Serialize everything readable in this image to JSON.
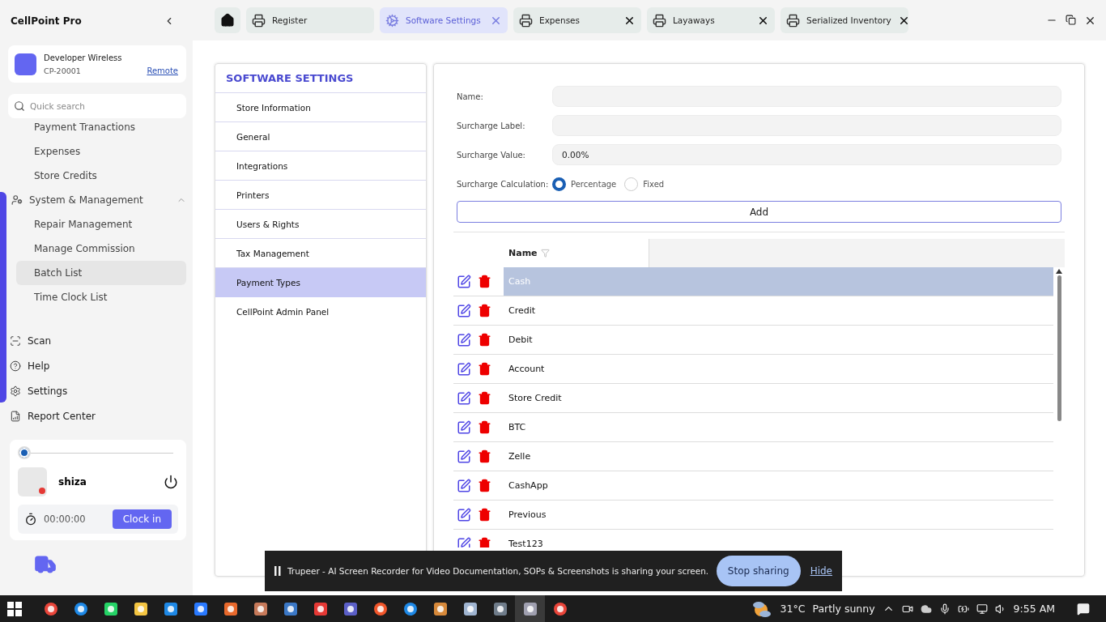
{
  "app": {
    "title": "CellPoint Pro"
  },
  "store": {
    "name": "Developer Wireless",
    "code": "CP-20001",
    "link": "Remote"
  },
  "search": {
    "placeholder": "Quick search"
  },
  "nav": {
    "items": [
      {
        "label": "Payment Tranactions",
        "selected": false
      },
      {
        "label": "Expenses",
        "selected": false
      },
      {
        "label": "Store Credits",
        "selected": false
      }
    ],
    "group": {
      "label": "System & Management",
      "expanded": true,
      "children": [
        {
          "label": "Repair Management",
          "selected": false
        },
        {
          "label": "Manage Commission",
          "selected": false
        },
        {
          "label": "Batch List",
          "selected": true
        },
        {
          "label": "Time Clock List",
          "selected": false
        }
      ]
    }
  },
  "shortcuts": [
    {
      "label": "Scan",
      "kind": "scan"
    },
    {
      "label": "Help",
      "kind": "help"
    },
    {
      "label": "Settings",
      "kind": "settings"
    },
    {
      "label": "Report Center",
      "kind": "report"
    }
  ],
  "user": {
    "name": "shiza",
    "slider": {
      "level": 0
    },
    "time": "00:00:00",
    "clock_button": "Clock in"
  },
  "tabs": [
    {
      "label": "Register",
      "kind": "printer",
      "selected": false,
      "closable": false
    },
    {
      "label": "Software Settings",
      "kind": "settings",
      "selected": true,
      "closable": true
    },
    {
      "label": "Expenses",
      "kind": "printer",
      "selected": false,
      "closable": true
    },
    {
      "label": "Layaways",
      "kind": "printer",
      "selected": false,
      "closable": true
    },
    {
      "label": "Serialized Inventory",
      "kind": "printer",
      "selected": false,
      "closable": true
    }
  ],
  "settings_menu": {
    "title": "SOFTWARE SETTINGS",
    "items": [
      {
        "label": "Store Information",
        "selected": false
      },
      {
        "label": "General",
        "selected": false
      },
      {
        "label": "Integrations",
        "selected": false
      },
      {
        "label": "Printers",
        "selected": false
      },
      {
        "label": "Users & Rights",
        "selected": false
      },
      {
        "label": "Tax Management",
        "selected": false
      },
      {
        "label": "Payment Types",
        "selected": true
      },
      {
        "label": "CellPoint Admin Panel",
        "selected": false
      }
    ]
  },
  "form": {
    "fields": [
      {
        "label": "Name:"
      },
      {
        "label": "Surcharge Label:"
      },
      {
        "label": "Surcharge Value:",
        "value": "0.00%"
      }
    ],
    "calculation": {
      "label": "Surcharge Calculation:",
      "options": [
        {
          "label": "Percentage",
          "selected": true
        },
        {
          "label": "Fixed",
          "selected": false
        }
      ]
    },
    "add_button": "Add"
  },
  "table": {
    "columns": [
      "Name"
    ],
    "rows": [
      {
        "name": "Cash",
        "selected": true
      },
      {
        "name": "Credit",
        "selected": false
      },
      {
        "name": "Debit",
        "selected": false
      },
      {
        "name": "Account",
        "selected": false
      },
      {
        "name": "Store Credit",
        "selected": false
      },
      {
        "name": "BTC",
        "selected": false
      },
      {
        "name": "Zelle",
        "selected": false
      },
      {
        "name": "CashApp",
        "selected": false
      },
      {
        "name": "Previous",
        "selected": false
      },
      {
        "name": "Test123",
        "selected": false
      }
    ]
  },
  "banner": {
    "text": "Trupeer - AI Screen Recorder for Video Documentation, SOPs & Screenshots is sharing your screen.",
    "stop": "Stop sharing",
    "hide": "Hide"
  },
  "taskbar": {
    "apps": [
      {
        "kind": "chrome",
        "selected": false
      },
      {
        "kind": "edge",
        "selected": false
      },
      {
        "kind": "whatsapp",
        "selected": false
      },
      {
        "kind": "folder",
        "selected": false
      },
      {
        "kind": "tiles",
        "selected": false
      },
      {
        "kind": "sync",
        "selected": false
      },
      {
        "kind": "r",
        "selected": false
      },
      {
        "kind": "paint",
        "selected": false
      },
      {
        "kind": "news",
        "selected": false
      },
      {
        "kind": "stripes",
        "selected": false
      },
      {
        "kind": "teams",
        "selected": false
      },
      {
        "kind": "brave",
        "selected": false
      },
      {
        "kind": "bluecircle",
        "selected": false
      },
      {
        "kind": "swirl",
        "selected": false
      },
      {
        "kind": "notepad",
        "selected": false
      },
      {
        "kind": "calculator",
        "selected": false
      },
      {
        "kind": "moon",
        "selected": true
      },
      {
        "kind": "chrome",
        "selected": false
      }
    ],
    "temperature": "31°C",
    "weather": "Partly sunny",
    "time": "9:55 AM"
  }
}
